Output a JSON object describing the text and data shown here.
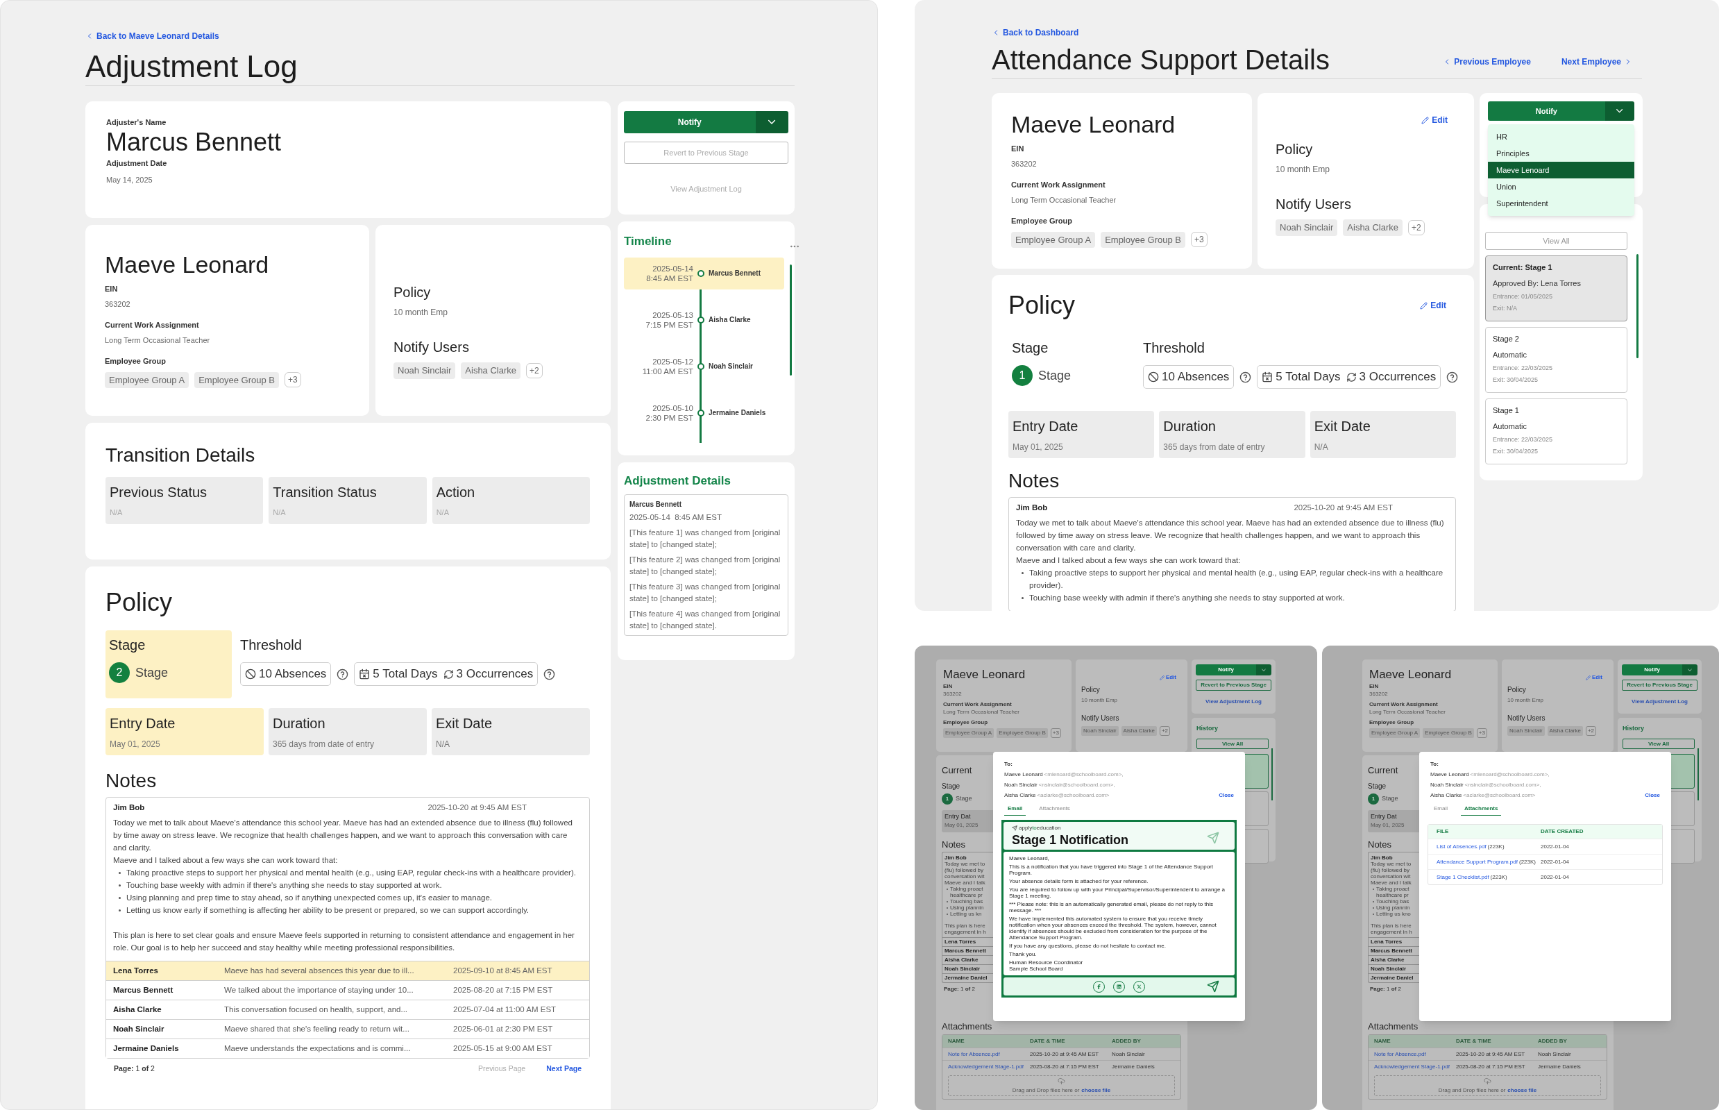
{
  "adjustment_log": {
    "back_link": "Back to Maeve Leonard Details",
    "title": "Adjustment Log",
    "adjuster": {
      "name_label": "Adjuster's Name",
      "name": "Marcus Bennett",
      "date_label": "Adjustment Date",
      "date": "May 14, 2025"
    },
    "actions": {
      "notify": "Notify",
      "revert": "Revert to Previous Stage",
      "view_log": "View Adjustment Log",
      "disabled": true
    },
    "employee": {
      "name": "Maeve Leonard",
      "ein_label": "EIN",
      "ein": "363202",
      "assignment_label": "Current Work Assignment",
      "assignment": "Long Term Occasional Teacher",
      "group_label": "Employee Group",
      "groups": [
        "Employee Group A",
        "Employee Group B"
      ],
      "groups_more": "+3"
    },
    "policy_card": {
      "policy_label": "Policy",
      "policy": "10 month Emp",
      "notify_label": "Notify Users",
      "users": [
        "Noah Sinclair",
        "Aisha Clarke"
      ],
      "more": "+2"
    },
    "timeline": {
      "title": "Timeline",
      "entries": [
        {
          "date": "2025-05-14",
          "time": "8:45 AM EST",
          "name": "Marcus Bennett",
          "selected": true
        },
        {
          "date": "2025-05-13",
          "time": "7:15 PM EST",
          "name": "Aisha Clarke",
          "selected": false
        },
        {
          "date": "2025-05-12",
          "time": "11:00 AM EST",
          "name": "Noah Sinclair",
          "selected": false
        },
        {
          "date": "2025-05-10",
          "time": "2:30 PM EST",
          "name": "Jermaine Daniels",
          "selected": false
        }
      ]
    },
    "transition": {
      "title": "Transition Details",
      "fields": [
        {
          "label": "Previous Status",
          "value": "N/A"
        },
        {
          "label": "Transition Status",
          "value": "N/A"
        },
        {
          "label": "Action",
          "value": "N/A"
        }
      ]
    },
    "adjustment_details": {
      "title": "Adjustment Details",
      "author": "Marcus Bennett",
      "timestamp": "2025-05-14  8:45 AM EST",
      "changes": [
        "[This feature 1] was changed from [original state] to [changed state];",
        "[This feature 2] was changed from [original state] to [changed state];",
        "[This feature 3] was changed from [original state] to [changed state];",
        "[This feature 4] was changed from [original state] to [changed state]."
      ]
    },
    "policy": {
      "title": "Policy",
      "stage_label": "Stage",
      "stage_number": "2",
      "stage_text": "Stage",
      "stage_highlighted": true,
      "threshold_label": "Threshold",
      "absences": "10 Absences",
      "total_days": "5 Total Days",
      "occurrences": "3 Occurrences",
      "dates": [
        {
          "label": "Entry Date",
          "value": "May 01, 2025",
          "highlighted": true
        },
        {
          "label": "Duration",
          "value": "365 days from date of entry",
          "highlighted": false
        },
        {
          "label": "Exit Date",
          "value": "N/A",
          "highlighted": false
        }
      ]
    },
    "notes": {
      "title": "Notes",
      "author": "Jim Bob",
      "timestamp": "2025-10-20 at 9:45 AM EST",
      "paragraphs": [
        "Today we met to talk about Maeve's attendance this school year. Maeve has had an extended absence due to illness (flu) followed by time away on stress leave. We recognize that health challenges happen, and we want to approach this conversation with care and clarity.",
        "Maeve and I talked about a few ways she can work toward that:"
      ],
      "bullets": [
        "Taking proactive steps to support her physical and mental health (e.g., using EAP, regular check-ins with a healthcare provider).",
        "Touching base weekly with admin if there's anything she needs to stay supported at work.",
        "Using planning and prep time to stay ahead, so if anything unexpected comes up, it's easier to manage.",
        "Letting us know early if something is affecting her ability to be present or prepared, so we can support accordingly."
      ],
      "closing": "This plan is here to set clear goals and ensure Maeve feels supported in returning to consistent attendance and engagement in her role. Our goal is to help her succeed and stay healthy while meeting professional responsibilities.",
      "rows": [
        {
          "author": "Lena Torres",
          "excerpt": "Maeve has had several absences this year due to ill...",
          "timestamp": "2025-09-10 at 8:45 AM EST",
          "selected": true
        },
        {
          "author": "Marcus Bennett",
          "excerpt": "We talked about the importance of staying under 10...",
          "timestamp": "2025-08-20 at 7:15 PM EST",
          "selected": false
        },
        {
          "author": "Aisha Clarke",
          "excerpt": "This conversation focused on health, support, and...",
          "timestamp": "2025-07-04 at 11:00 AM EST",
          "selected": false
        },
        {
          "author": "Noah Sinclair",
          "excerpt": "Maeve shared that she's feeling ready to return wit...",
          "timestamp": "2025-06-01 at 2:30 PM EST",
          "selected": false
        },
        {
          "author": "Jermaine Daniels",
          "excerpt": "Maeve understands the expectations and is commi...",
          "timestamp": "2025-05-15 at 9:00 AM EST",
          "selected": false
        }
      ],
      "pagination": {
        "page": "**Page:** 1 **of** 2",
        "previous": "Previous Page",
        "next": "Next Page",
        "previous_disabled": true
      }
    }
  },
  "attendance_details": {
    "back_link": "Back to Dashboard",
    "title": "Attendance Support Details",
    "previous": "Previous Employee",
    "next": "Next Employee",
    "employee": {
      "name": "Maeve Leonard",
      "ein_label": "EIN",
      "ein": "363202",
      "assignment_label": "Current Work Assignment",
      "assignment": "Long Term Occasional Teacher",
      "group_label": "Employee Group",
      "groups": [
        "Employee Group A",
        "Employee Group B"
      ],
      "groups_more": "+3"
    },
    "policy_card": {
      "edit": "Edit",
      "policy_label": "Policy",
      "policy": "10 month Emp",
      "notify_label": "Notify Users",
      "users": [
        "Noah Sinclair",
        "Aisha Clarke"
      ],
      "more": "+2"
    },
    "notify": {
      "label": "Notify",
      "options": [
        {
          "label": "HR",
          "selected": false
        },
        {
          "label": "Principles",
          "selected": false
        },
        {
          "label": "Maeve Lenoard",
          "selected": true
        },
        {
          "label": "Union",
          "selected": false
        },
        {
          "label": "Superintendent",
          "selected": false
        }
      ]
    },
    "history": {
      "view_all": "View All",
      "items": [
        {
          "title": "Current: Stage 1",
          "line": "Approved By: Lena Torres",
          "entrance": "Entrance: 01/05/2025",
          "exit": "Exit: N/A",
          "selected": true
        },
        {
          "title": "Stage 2",
          "line": "Automatic",
          "entrance": "Entrance: 22/03/2025",
          "exit": "Exit: 30/04/2025",
          "selected": false
        },
        {
          "title": "Stage 1",
          "line": "Automatic",
          "entrance": "Entrance: 22/03/2025",
          "exit": "Exit: 30/04/2025",
          "selected": false
        }
      ]
    },
    "policy": {
      "title": "Policy",
      "edit": "Edit",
      "stage_label": "Stage",
      "stage_number": "1",
      "stage_text": "Stage",
      "stage_highlighted": false,
      "threshold_label": "Threshold",
      "absences": "10 Absences",
      "total_days": "5 Total Days",
      "occurrences": "3 Occurrences",
      "dates": [
        {
          "label": "Entry Date",
          "value": "May 01, 2025",
          "highlighted": false
        },
        {
          "label": "Duration",
          "value": "365 days from date of entry",
          "highlighted": false
        },
        {
          "label": "Exit Date",
          "value": "N/A",
          "highlighted": false
        }
      ]
    },
    "notes": {
      "title": "Notes",
      "author": "Jim Bob",
      "timestamp": "2025-10-20 at 9:45 AM EST",
      "paragraphs": [
        "Today we met to talk about Maeve's attendance this school year. Maeve has had an extended absence due to illness (flu) followed by time away on stress leave. We recognize that health challenges happen, and we want to approach this conversation with care and clarity.",
        "Maeve and I talked about a few ways she can work toward that:"
      ],
      "bullets": [
        "Taking proactive steps to support her physical and mental health (e.g., using EAP, regular check-ins with a healthcare provider).",
        "Touching base weekly with admin if there's anything she needs to stay supported at work."
      ]
    }
  },
  "email_preview": {
    "background": {
      "employee": {
        "name": "Maeve Leonard",
        "ein_label": "EIN",
        "ein": "363202",
        "assignment_label": "Current Work Assignment",
        "assignment": "Long Term Occasional Teacher",
        "group_label": "Employee Group",
        "groups": [
          "Employee Group A",
          "Employee Group B"
        ],
        "groups_more": "+3"
      },
      "policy_card": {
        "edit": "Edit",
        "policy_label": "Policy",
        "policy": "10 month Emp",
        "notify_label": "Notify Users",
        "users": [
          "Noah Sinclair",
          "Aisha Clarke"
        ],
        "more": "+2"
      },
      "actions": {
        "notify": "Notify",
        "revert": "Revert to Previous Stage",
        "view_log": "View Adjustment Log"
      },
      "history": {
        "title": "History",
        "view_all": "View All",
        "items": [
          {
            "selected": true
          },
          {
            "selected": false
          },
          {
            "selected": false
          }
        ]
      },
      "current": {
        "title": "Current",
        "stage_label": "Stage",
        "stage_number": "1",
        "stage_text": "Stage",
        "entry_label": "Entry Dat",
        "entry_value": "May 01, 2025",
        "notes_title": "Notes",
        "notes_author": "Jim Bob",
        "note_lines": [
          {
            "text": "Today we met to",
            "kind": "line"
          },
          {
            "text": "(flu) followed by",
            "kind": "line"
          },
          {
            "text": "conversation wit",
            "kind": "line"
          },
          {
            "text": "Maeve and I talk",
            "kind": "line"
          },
          {
            "text": "Taking proact",
            "kind": "bullet"
          },
          {
            "text": "healthcare pr",
            "kind": "continuation"
          },
          {
            "text": "Touching bas",
            "kind": "bullet"
          },
          {
            "text": "Using plannin",
            "kind": "bullet"
          },
          {
            "text": "Letting us kn",
            "kind": "bullet"
          },
          {
            "text": "This plan is here",
            "kind": "gap"
          },
          {
            "text": "engagement in h",
            "kind": "line"
          }
        ],
        "authors": [
          "Lena Torres",
          "Marcus Bennett",
          "Aisha Clarke",
          "Noah Sinclair",
          "Jermaine Daniel"
        ],
        "page": "**Page:** 1 **of** 2"
      },
      "attachments": {
        "title": "Attachments",
        "columns": [
          "NAME",
          "DATE & TIME",
          "ADDED BY"
        ],
        "rows": [
          {
            "name": "Note for Absence.pdf",
            "date": "2025-10-20 at 9:45 AM EST",
            "added_by": "Noah Sinclair"
          },
          {
            "name": "Acknowledgement Stage-1.pdf",
            "date": "2025-08-20 at 7:15 PM EST",
            "added_by": "Jermaine Daniels"
          }
        ],
        "upload_text": "Drag and Drop files here or",
        "upload_link": "choose file"
      }
    },
    "modal": {
      "to_label": "To:",
      "recipients": [
        {
          "name": "Maeve Leonard",
          "email": "<mlenoard@schoolboard.com>,"
        },
        {
          "name": "Noah Sinclair",
          "email": "<nsinclair@schoolboard.com>,"
        },
        {
          "name": "Aisha Clarke",
          "email": "<aclarke@schoolboard.com>"
        }
      ],
      "close": "Close",
      "tabs": [
        {
          "label": "Email",
          "selected": true
        },
        {
          "label": "Attachments",
          "selected": false
        }
      ],
      "email": {
        "logo": [
          {
            "text": "apply",
            "accent": false
          },
          {
            "text": "to",
            "accent": true
          },
          {
            "text": "education",
            "accent": false
          }
        ],
        "heading": "Stage 1 Notification",
        "paragraphs": [
          "Maeve Leonard,",
          "This is a notification that you have triggered into Stage 1 of the Attendance Support Program.",
          "Your absence details form is attached for your reference.",
          "You are required to follow up with your Principal/Supervisor/Superintendent to arrange a Stage 1 meeting.",
          "*** Please note: this is an automatically generated email, please do not reply to this message. ***",
          "We have implemented this automated system to ensure that you receive timely notification when your absences exceed the threshold. The system, however, cannot identify if absences should be excluded from consideration for the purpose of the Attendance Support Program.",
          "If you have any questions, please do not hesitate to contact me.",
          "Thank you."
        ],
        "signature": [
          "Human Resource Coordinator",
          "Sample School Board"
        ]
      }
    }
  },
  "attachments_preview": {
    "background": {
      "employee": {
        "name": "Maeve Leonard",
        "ein_label": "EIN",
        "ein": "363202",
        "assignment_label": "Current Work Assignment",
        "assignment": "Long Term Occasional Teacher",
        "group_label": "Employee Group",
        "groups": [
          "Employee Group A",
          "Employee Group B"
        ],
        "groups_more": "+3"
      },
      "policy_card": {
        "edit": "Edit",
        "policy_label": "Policy",
        "policy": "10 month Emp",
        "notify_label": "Notify Users",
        "users": [
          "Noah Sinclair",
          "Aisha Clarke"
        ],
        "more": "+2"
      },
      "actions": {
        "notify": "Notify",
        "revert": "Revert to Previous Stage",
        "view_log": "View Adjustment Log"
      },
      "history": {
        "title": "History",
        "view_all": "View All",
        "items": [
          {
            "selected": true
          },
          {
            "selected": false
          },
          {
            "selected": false
          }
        ]
      },
      "current": {
        "title": "Current",
        "stage_label": "Stage",
        "stage_number": "1",
        "stage_text": "Stage",
        "entry_label": "Entry Dat",
        "entry_value": "May 01, 2025",
        "notes_title": "Notes",
        "notes_author": "Jim Bob",
        "note_lines": [
          {
            "text": "Today we met to",
            "kind": "line"
          },
          {
            "text": "(flu) followed by",
            "kind": "line"
          },
          {
            "text": "conversation wit",
            "kind": "line"
          },
          {
            "text": "Maeve and I talk",
            "kind": "line"
          },
          {
            "text": "Taking proact",
            "kind": "bullet"
          },
          {
            "text": "healthcare pr",
            "kind": "continuation"
          },
          {
            "text": "Touching bas",
            "kind": "bullet"
          },
          {
            "text": "Using plannin",
            "kind": "bullet"
          },
          {
            "text": "Letting us kno",
            "kind": "bullet"
          },
          {
            "text": "This plan is here",
            "kind": "gap"
          },
          {
            "text": "engagement in h",
            "kind": "line"
          }
        ],
        "authors": [
          "Lena Torres",
          "Marcus Bennett",
          "Aisha Clarke",
          "Noah Sinclair",
          "Jermaine Daniel"
        ],
        "page": "**Page:** 1 **of** 2"
      },
      "attachments": {
        "title": "Attachments",
        "columns": [
          "NAME",
          "DATE & TIME",
          "ADDED BY"
        ],
        "rows": [
          {
            "name": "Note for Absence.pdf",
            "date": "2025-10-20 at 9:45 AM EST",
            "added_by": "Noah Sinclair"
          },
          {
            "name": "Acknowledgement Stage-1.pdf",
            "date": "2025-08-20 at 7:15 PM EST",
            "added_by": "Jermaine Daniels"
          }
        ],
        "upload_text": "Drag and Drop files here or",
        "upload_link": "choose file"
      }
    },
    "modal": {
      "to_label": "To:",
      "recipients": [
        {
          "name": "Maeve Leonard",
          "email": "<mlenoard@schoolboard.com>,"
        },
        {
          "name": "Noah Sinclair",
          "email": "<nsinclair@schoolboard.com>,"
        },
        {
          "name": "Aisha Clarke",
          "email": "<aclarke@schoolboard.com>"
        }
      ],
      "close": "Close",
      "tabs": [
        {
          "label": "Email",
          "selected": false
        },
        {
          "label": "Attachments",
          "selected": true
        }
      ],
      "files": {
        "columns": [
          "FILE",
          "DATE CREATED"
        ],
        "rows": [
          {
            "file": "List of Absences.pdf",
            "size": "(223K)",
            "date": "2022-01-04"
          },
          {
            "file": "Attendance Support Program.pdf",
            "size": "(223K)",
            "date": "2022-01-04"
          },
          {
            "file": "Stage 1 Checklist.pdf",
            "size": "(223K)",
            "date": "2022-01-04"
          }
        ]
      }
    }
  }
}
